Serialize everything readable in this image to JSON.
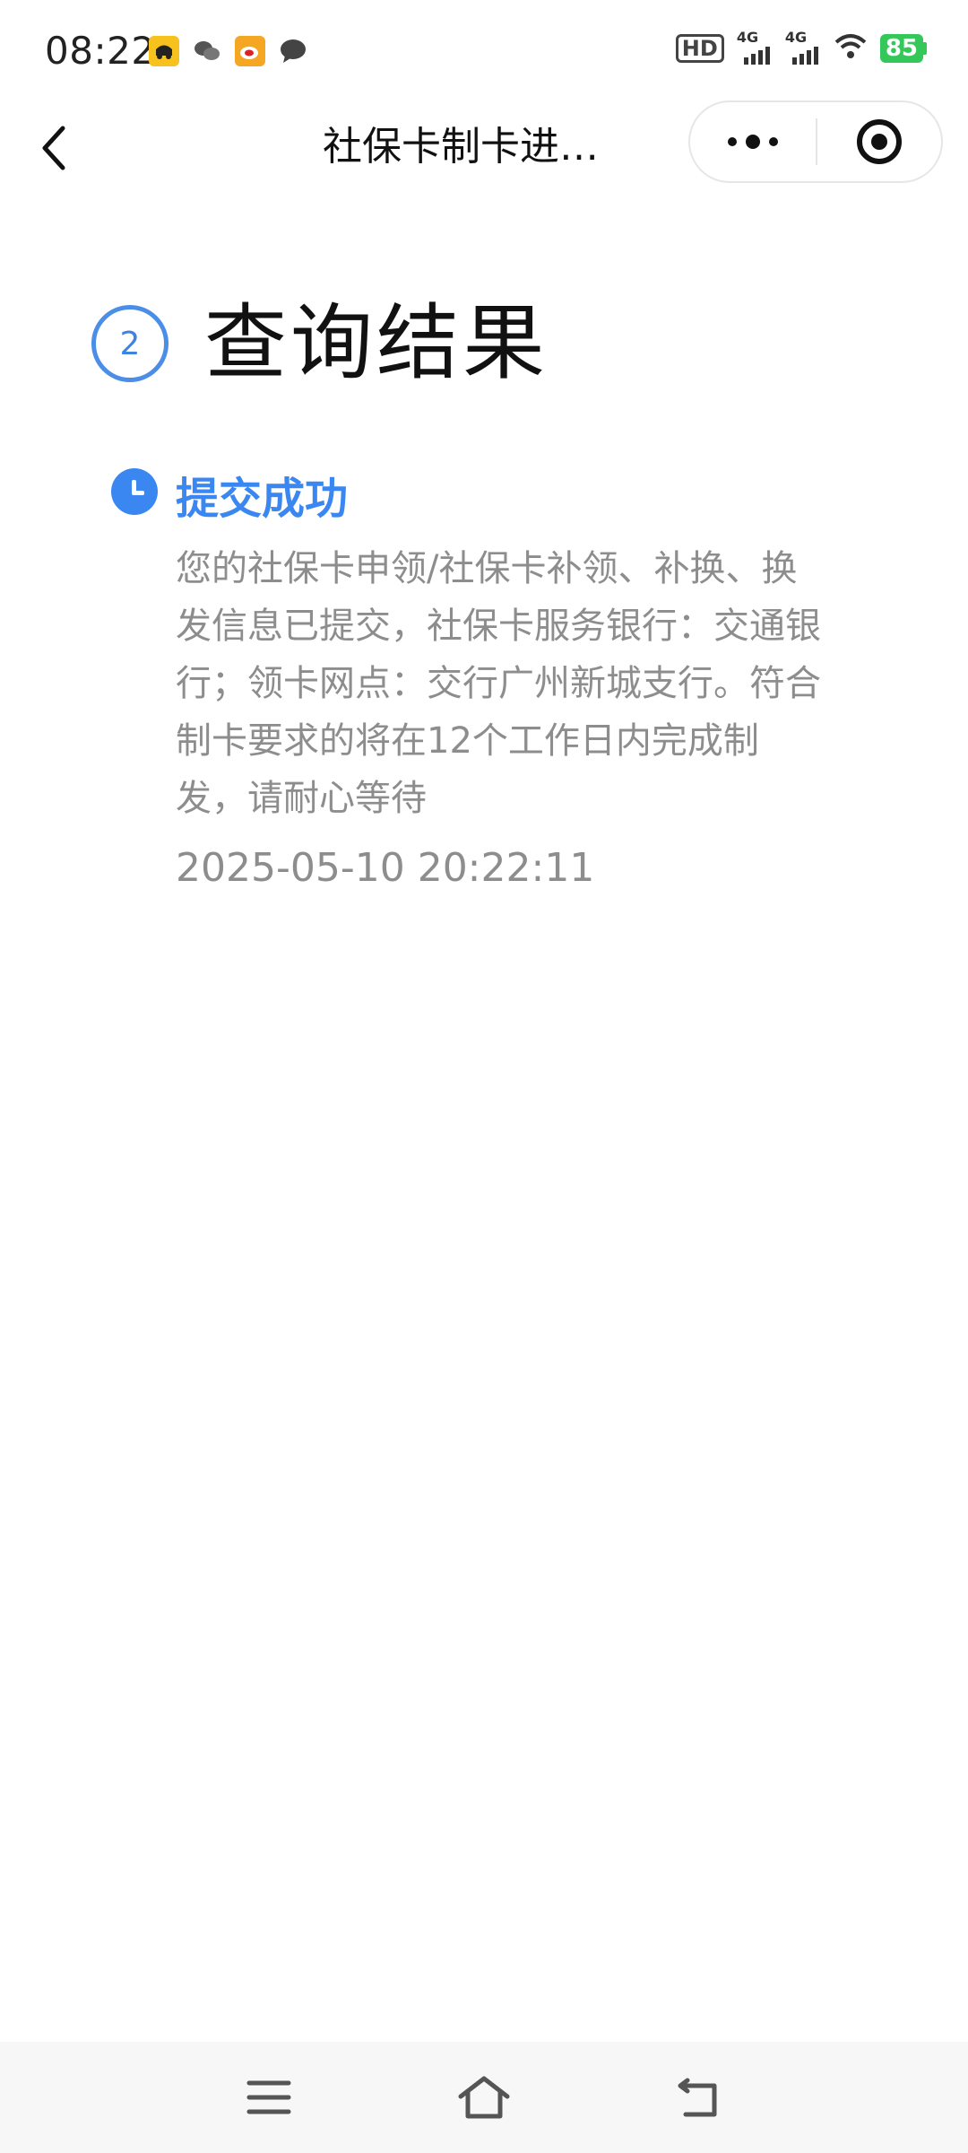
{
  "status_bar": {
    "time": "08:22",
    "hd_label": "HD",
    "sim1_label": "4G",
    "sim2_label": "4G",
    "battery_level": "85",
    "app_icons": [
      "didi-icon",
      "wechat-icon",
      "weibo-icon",
      "message-icon"
    ]
  },
  "nav": {
    "title": "社保卡制卡进…"
  },
  "step": {
    "number": "2",
    "title": "查询结果"
  },
  "timeline": [
    {
      "status": "提交成功",
      "description": "您的社保卡申领/社保卡补领、补换、换发信息已提交，社保卡服务银行：交通银行；领卡网点：交行广州新城支行。符合制卡要求的将在12个工作日内完成制发，请耐心等待",
      "time": "2025-05-10 20:22:11"
    }
  ],
  "colors": {
    "accent": "#3a87f2",
    "step_ring": "#4a8ee8",
    "muted_text": "#8d8d8d",
    "battery": "#34c759"
  }
}
